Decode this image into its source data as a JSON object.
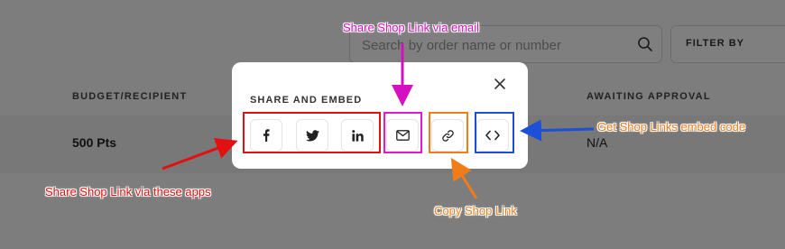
{
  "background": {
    "search": {
      "placeholder": "Search by order name or number"
    },
    "filter_button": {
      "label": "FILTER BY"
    },
    "table": {
      "columns": [
        "BUDGET/RECIPIENT",
        "AWAITING APPROVAL"
      ],
      "row": {
        "budget": "500 Pts",
        "awaiting": "N/A"
      }
    }
  },
  "modal": {
    "title": "SHARE AND EMBED",
    "buttons": [
      {
        "icon": "facebook-icon"
      },
      {
        "icon": "twitter-icon"
      },
      {
        "icon": "linkedin-icon"
      },
      {
        "icon": "mail-icon"
      },
      {
        "icon": "link-icon"
      },
      {
        "icon": "code-embed-icon"
      }
    ]
  },
  "annotations": {
    "apps": "Share Shop Link via these apps",
    "email": "Share Shop Link via email",
    "copy": "Copy Shop Link",
    "embed": "Get Shop Links embed code"
  },
  "colors": {
    "red": "#e21010",
    "magenta": "#e815d2",
    "orange": "#f07d1a",
    "blue": "#1d4fd7"
  }
}
